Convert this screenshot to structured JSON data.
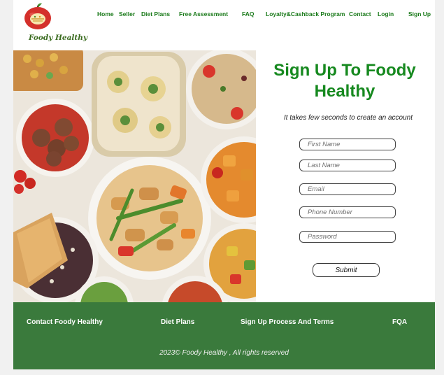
{
  "brand": {
    "name": "Foody Healthy"
  },
  "nav": {
    "items": [
      {
        "label": "Home"
      },
      {
        "label": "Seller"
      },
      {
        "label": "Diet Plans"
      },
      {
        "label": "Free Assessment"
      },
      {
        "label": "FAQ"
      },
      {
        "label": "Loyalty&Cashback Program"
      },
      {
        "label": "Contact"
      },
      {
        "label": "Login"
      },
      {
        "label": "Sign Up"
      }
    ]
  },
  "hero": {
    "image": "food-platter-photo"
  },
  "form": {
    "title": "Sign Up To Foody Healthy",
    "subtitle": "It takes few seconds to create an account",
    "fields": [
      {
        "placeholder": "First Name",
        "value": ""
      },
      {
        "placeholder": "Last Name",
        "value": ""
      },
      {
        "placeholder": "Email",
        "value": ""
      },
      {
        "placeholder": "Phone Number",
        "value": ""
      },
      {
        "placeholder": "Password",
        "value": ""
      }
    ],
    "submit_label": "Submit"
  },
  "footer": {
    "links": [
      {
        "label": "Contact Foody Healthy"
      },
      {
        "label": "Diet Plans"
      },
      {
        "label": "Sign Up Process And Terms"
      },
      {
        "label": "FQA"
      }
    ],
    "copyright": "2023© Foody Healthy , All rights reserved"
  },
  "colors": {
    "brand_green": "#16891f",
    "nav_green": "#1a7a1a",
    "footer_green": "#3a7a3c",
    "apple_red": "#d4302b"
  }
}
